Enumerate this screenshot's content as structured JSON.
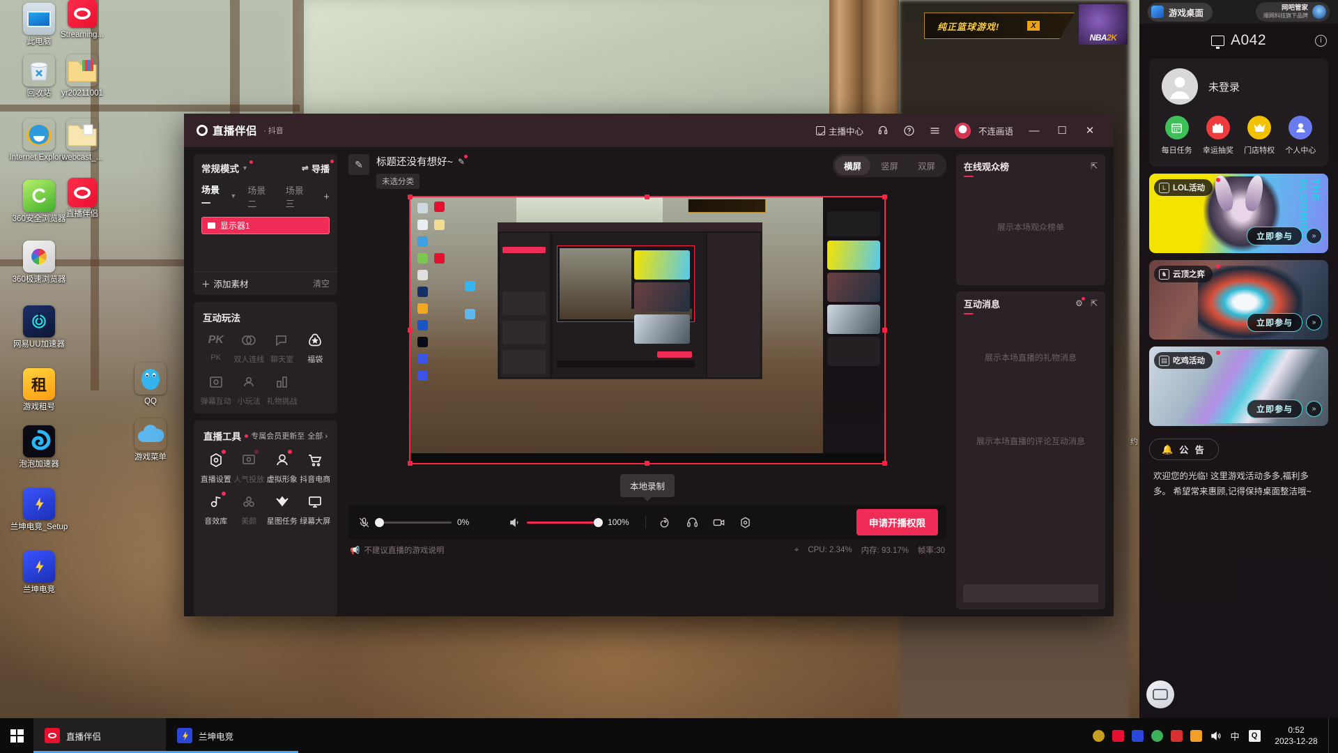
{
  "desktop": {
    "icons": [
      {
        "label": "此电脑",
        "icon": "this-pc-icon",
        "kind": "pc"
      },
      {
        "label": "Streaming...",
        "icon": "streaming-app-icon",
        "kind": "red"
      },
      {
        "label": "回收站",
        "icon": "recycle-bin-icon",
        "kind": "bin"
      },
      {
        "label": "yr20211001",
        "icon": "folder-icon",
        "kind": "folder"
      },
      {
        "label": "Internet Explorer",
        "icon": "internet-explorer-icon",
        "kind": "ie"
      },
      {
        "label": "webcast_...",
        "icon": "folder-icon",
        "kind": "folder"
      },
      {
        "label": "360安全浏览器",
        "icon": "360-secure-browser-icon",
        "kind": "360s"
      },
      {
        "label": "直播伴侣",
        "icon": "live-companion-icon",
        "kind": "red"
      },
      {
        "label": "360极速浏览器",
        "icon": "360-speed-browser-icon",
        "kind": "360b"
      },
      {
        "label": "网易UU加速器",
        "icon": "uu-booster-icon",
        "kind": "uu"
      },
      {
        "label": "游戏租号",
        "icon": "game-account-rental-icon",
        "kind": "zu"
      },
      {
        "label": "QQ",
        "icon": "qq-icon",
        "kind": "qq"
      },
      {
        "label": "泡泡加速器",
        "icon": "paopao-booster-icon",
        "kind": "pao"
      },
      {
        "label": "游戏菜单",
        "icon": "game-menu-icon",
        "kind": "cloud"
      },
      {
        "label": "兰坤电竞_Setup",
        "icon": "lankun-esports-setup-icon",
        "kind": "lan"
      },
      {
        "label": "兰坤电竞",
        "icon": "lankun-esports-icon",
        "kind": "lan"
      }
    ]
  },
  "nba_banner": {
    "slogan": "纯正篮球游戏!",
    "close_label": "X",
    "logo_text": "NBA",
    "logo_accent": "2K"
  },
  "app": {
    "brand_name": "直播伴侣",
    "brand_sub": "· 抖音",
    "titlebar": {
      "anchor_center": "主播中心",
      "headset_icon": "headset-icon",
      "help_icon": "help-icon",
      "menu_icon": "hamburger-menu-icon",
      "account_name": "不连画语",
      "minimize": "—",
      "maximize": "☐",
      "close": "✕"
    },
    "left": {
      "mode_label": "常规模式",
      "director_label": "导播",
      "scenes": [
        "场景一",
        "场景二",
        "场景三"
      ],
      "scene_add": "+",
      "sources": [
        {
          "label": "显示器1",
          "icon": "monitor-icon"
        }
      ],
      "add_source": "添加素材",
      "clear_source": "清空",
      "interact_title": "互动玩法",
      "interact_items": [
        {
          "label": "PK",
          "icon": "pk-icon",
          "dim": true
        },
        {
          "label": "双人连线",
          "icon": "link-two-icon",
          "dim": true
        },
        {
          "label": "聊天室",
          "icon": "chat-room-icon",
          "dim": true
        },
        {
          "label": "福袋",
          "icon": "lucky-bag-icon",
          "dim": false
        },
        {
          "label": "弹幕互动",
          "icon": "danmaku-icon",
          "dim": true
        },
        {
          "label": "小玩法",
          "icon": "mini-game-icon",
          "dim": true
        },
        {
          "label": "礼物挑战",
          "icon": "gift-challenge-icon",
          "dim": true
        }
      ],
      "tools_title": "直播工具",
      "tools_note": "专属会员更新至",
      "tools_all": "全部 ›",
      "tools_items": [
        {
          "label": "直播设置",
          "icon": "settings-gear-icon",
          "dim": false,
          "dot": true
        },
        {
          "label": "人气投放",
          "icon": "popularity-icon",
          "dim": true,
          "dot": true
        },
        {
          "label": "虚拟形象",
          "icon": "avatar-icon",
          "dim": false,
          "dot": true
        },
        {
          "label": "抖音电商",
          "icon": "shopping-cart-icon",
          "dim": false,
          "dot": false
        },
        {
          "label": "音效库",
          "icon": "sound-effects-icon",
          "dim": false,
          "dot": true
        },
        {
          "label": "美颜",
          "icon": "beauty-icon",
          "dim": true,
          "dot": false
        },
        {
          "label": "星图任务",
          "icon": "star-task-icon",
          "dim": false,
          "dot": false
        },
        {
          "label": "绿幕大屏",
          "icon": "green-screen-icon",
          "dim": false,
          "dot": false
        }
      ]
    },
    "center": {
      "cover_icon": "edit-cover-icon",
      "title": "标题还没有想好~",
      "edit_icon": "edit-pencil-icon",
      "category": "未选分类",
      "mode_tabs": [
        {
          "label": "横屏",
          "active": true
        },
        {
          "label": "竖屏",
          "active": false
        },
        {
          "label": "双屏",
          "active": false
        }
      ],
      "record_tooltip": "本地录制",
      "mic": {
        "icon": "microphone-muted-icon",
        "value": "0%",
        "percent": 0
      },
      "speaker": {
        "icon": "speaker-icon",
        "value": "100%",
        "percent": 100
      },
      "control_icons": [
        "beauty-face-icon",
        "headset-icon",
        "camera-icon",
        "settings-gear-icon"
      ],
      "apply_button": "申请开播权限",
      "status_note": "不建议直播的游戏说明",
      "status_icon": "megaphone-icon",
      "perf_icon": "performance-icon",
      "cpu": "CPU: 2.34%",
      "memory": "内存: 93.17%",
      "fps": "帧率:30"
    },
    "right": {
      "viewers_title": "在线观众榜",
      "viewers_empty": "展示本场观众榜单",
      "viewers_expand_icon": "expand-icon",
      "messages_title": "互动消息",
      "messages_empty": "展示本场直播的礼物消息",
      "messages_empty2": "展示本场直播的评论互动消息",
      "messages_settings_icon": "settings-gear-icon",
      "messages_expand_icon": "expand-icon"
    }
  },
  "cafe": {
    "tab_label": "游戏桌面",
    "brand_title": "网吧管家",
    "brand_sub": "顺网科技旗下品牌",
    "pc_id": "A042",
    "pc_icon": "monitor-icon",
    "info_icon": "info-icon",
    "login_text": "未登录",
    "avatar_icon": "user-avatar-icon",
    "quick_actions": [
      {
        "label": "每日任务",
        "icon": "calendar-icon",
        "color": "#3fbf5a"
      },
      {
        "label": "幸运抽奖",
        "icon": "gift-icon",
        "color": "#ef3b3b"
      },
      {
        "label": "门店特权",
        "icon": "crown-icon",
        "color": "#f2c200"
      },
      {
        "label": "个人中心",
        "icon": "person-icon",
        "color": "#6a7bf0"
      }
    ],
    "promos": [
      {
        "id": "promo-lol",
        "badge": "LOL活动",
        "badge_icon": "lol-icon",
        "cta": "立即参与",
        "arrow_icon": "chevron-right-icon",
        "vertical_text": "THE GLOOMIST"
      },
      {
        "id": "promo-tft",
        "badge": "云顶之弈",
        "badge_icon": "tft-icon",
        "cta": "立即参与",
        "arrow_icon": "chevron-right-icon"
      },
      {
        "id": "promo-pubg",
        "badge": "吃鸡活动",
        "badge_icon": "pubg-icon",
        "cta": "立即参与",
        "arrow_icon": "chevron-right-icon"
      }
    ],
    "notice_icon": "bell-icon",
    "notice_title": "公 告",
    "notice_body": "欢迎您的光临! 这里游戏活动多多,福利多多。 希望常来惠顾,记得保持桌面整洁哦~",
    "chat_icon": "chat-bubble-icon",
    "edge_hints": [
      "约"
    ]
  },
  "taskbar": {
    "start_icon": "windows-start-icon",
    "tasks": [
      {
        "label": "直播伴侣",
        "icon": "live-companion-icon",
        "color": "#e8102f",
        "active": true
      },
      {
        "label": "兰坤电竞",
        "icon": "lankun-esports-icon",
        "color": "#2b47d8",
        "active": false
      }
    ],
    "tray": [
      {
        "icon": "tray-app-icon",
        "color": "#c8a020"
      },
      {
        "icon": "tray-live-companion-icon",
        "color": "#e8102f"
      },
      {
        "icon": "tray-lankun-icon",
        "color": "#2b47d8"
      },
      {
        "icon": "tray-cloud-icon",
        "color": "#3fb05a"
      },
      {
        "icon": "tray-red-icon",
        "color": "#d93030"
      },
      {
        "icon": "tray-orange-icon",
        "color": "#f0a028"
      }
    ],
    "volume_icon": "volume-icon",
    "ime_label": "中",
    "ime_icon": "ime-icon",
    "time": "0:52",
    "date": "2023-12-28"
  }
}
